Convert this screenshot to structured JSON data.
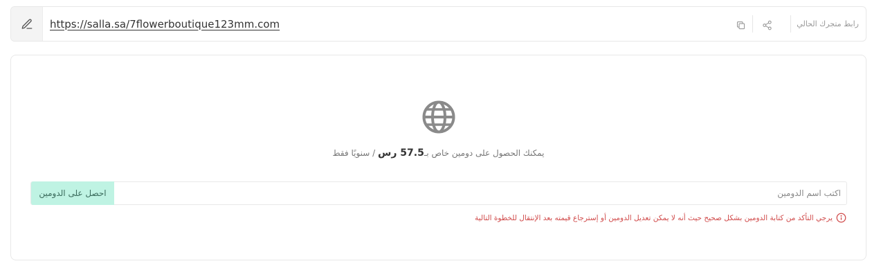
{
  "url_bar": {
    "label": "رابط متجرك الحالي",
    "url": "https://salla.sa/7flowerboutique123mm.com",
    "icons": {
      "edit": "edit-pencil-icon",
      "share": "share-icon",
      "copy": "copy-icon"
    }
  },
  "domain_card": {
    "icon": "globe-icon",
    "offer_prefix": "يمكنك الحصول على دومين خاص بـ",
    "offer_price": "57.5 رس",
    "offer_suffix": " / سنويًا فقط",
    "input_placeholder": "اكتب اسم الدومين",
    "input_value": "",
    "button_label": "احصل على الدومين",
    "warning_icon": "info-circle-icon",
    "warning_text": "يرجي التأكد من كتابة الدومين بشكل صحيح حيث أنه لا يمكن تعديل الدومين أو إسترجاع قيمته بعد الإنتقال للخطوة التالية"
  },
  "colors": {
    "button_bg": "#bff3e3",
    "button_text": "#3a6b5c",
    "warning": "#d04a4a",
    "globe": "#8a8a8a"
  }
}
